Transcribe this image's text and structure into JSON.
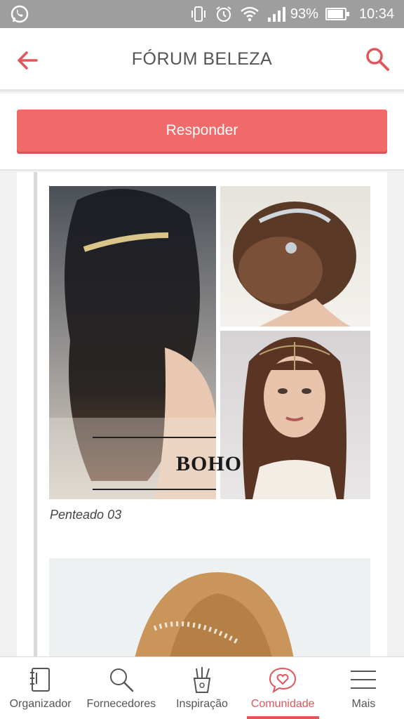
{
  "status_bar": {
    "battery": "93%",
    "battery_level": 0.93,
    "time": "10:34"
  },
  "header": {
    "title": "FÓRUM BELEZA"
  },
  "reply": {
    "label": "Responder"
  },
  "post": {
    "collage_text": "BOHO",
    "caption": "Penteado 03"
  },
  "nav": {
    "items": [
      {
        "label": "Organizador",
        "icon": "notebook-icon"
      },
      {
        "label": "Fornecedores",
        "icon": "search-icon"
      },
      {
        "label": "Inspiração",
        "icon": "brushes-cup-icon"
      },
      {
        "label": "Comunidade",
        "icon": "heart-chat-icon",
        "active": true
      },
      {
        "label": "Mais",
        "icon": "menu-icon"
      }
    ]
  },
  "colors": {
    "accent": "#f06a6a",
    "active_nav": "#e0565b",
    "status_bar": "#9e9e9e"
  }
}
